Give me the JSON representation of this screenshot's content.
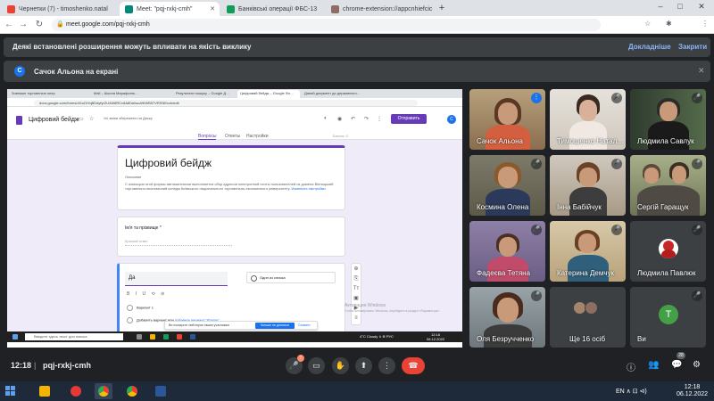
{
  "browser": {
    "tabs": [
      {
        "label": "Чернетки (7) - timoshenko.natal",
        "active": false
      },
      {
        "label": "Meet: \"pqj-rxkj-cmh\"",
        "active": true
      },
      {
        "label": "Банківські операції ФБС-13",
        "active": false
      },
      {
        "label": "chrome-extension://appcnhiefcic",
        "active": false
      }
    ],
    "new_tab": "+",
    "window_controls": {
      "minimize": "–",
      "maximize": "□",
      "close": "✕"
    },
    "url": "meet.google.com/pqj-rxkj-cmh",
    "nav": {
      "back": "←",
      "forward": "→",
      "reload": "↻"
    },
    "toolbar_icons": [
      "☆",
      "✱",
      "⋮"
    ]
  },
  "notice": {
    "text": "Деякі встановлені розширення можуть впливати на якість виклику",
    "details": "Докладніше",
    "close": "Закрити"
  },
  "presenting": {
    "badge": "С",
    "text": "Сачок Альона на екрані",
    "close": "✕"
  },
  "shared_screen": {
    "tabs": [
      "Зовнішні торговельні опер",
      "Mail – Школа Марафоню…",
      "Результати пошуку – Google Д…",
      "Цифровий бейдж – Google Фо…",
      "Даний документ до державного…"
    ],
    "url": "docs.google.com/forms/d/1uDiYqBDdyfyrZU4W8RCv6A80a0uuA9IWB57VRSNEcvk/edit",
    "form_name": "Цифровий бейдж",
    "saved_note": "Усі зміни збережено на Диску",
    "send": "Отправить",
    "avatar": "C",
    "form_tabs": [
      "Вопросы",
      "Ответы",
      "Настройки"
    ],
    "points": "Баллы: 0",
    "form_title": "Цифровий бейдж",
    "form_desc_label": "Описание",
    "form_desc": "С помощью этой формы автоматически выполняется сбор адресов электронной почты пользователей из домена Вінницький торговельно-економічний коледж Київського національного торговельно-економічного університету.",
    "form_desc_link": "Изменить настройки",
    "q1_title": "Ім'я та прізвище *",
    "q1_placeholder": "Краткий ответ",
    "q2_input": "Да",
    "q2_type": "Один из списка",
    "q2_format": "B I U ⟲ ⊘",
    "q2_option1": "Вариант 1",
    "q2_option2_text": "Добавить вариант или",
    "q2_option2_link": "добавить вариант \"Другое\"",
    "side_tools": [
      "⊕",
      "⎘",
      "Tт",
      "▣",
      "▶",
      "≡"
    ],
    "watermark_title": "Активация Windows",
    "watermark_text": "Чтобы активировать Windows, перейдите в раздел «Параметры».",
    "share_text": "Ви показуєте свій екран іншим учасникам",
    "share_stop": "Більше не ділитися",
    "share_hide": "Сховати",
    "taskbar_search": "Введите здесь текст для поиска",
    "taskbar_tray": "4°C Cloudy  ∧  ⊕  РУС",
    "taskbar_time": "12:18",
    "taskbar_date": "06.12.2022"
  },
  "participants": [
    {
      "name": "Сачок Альона",
      "mic": "on"
    },
    {
      "name": "Тимошенко Натал…",
      "mic": "off"
    },
    {
      "name": "Людмила Савлук",
      "mic": "off"
    },
    {
      "name": "Космина Олена",
      "mic": "off"
    },
    {
      "name": "Інна Бабійчук",
      "mic": "off"
    },
    {
      "name": "Сергій Гаращук",
      "mic": "off"
    },
    {
      "name": "Фадеєва Тетяна",
      "mic": "off"
    },
    {
      "name": "Катерина Демчук",
      "mic": "off"
    },
    {
      "name": "Людмила Павлюк",
      "mic": "off"
    },
    {
      "name": "Оля Безручченко",
      "mic": "off"
    },
    {
      "name": "Ще 16 осіб",
      "mic": ""
    },
    {
      "name": "Ви",
      "mic": "off",
      "avatar": "T"
    }
  ],
  "meetbar": {
    "time": "12:18",
    "separator": "|",
    "code": "pqj-rxkj-cmh",
    "mic_badge": "!",
    "buttons": {
      "mic": "🎤",
      "camera": "▭",
      "hand": "✋",
      "present": "⬆",
      "more": "⋮",
      "end": "☎"
    },
    "right": {
      "info": "ⓘ",
      "people": "👥",
      "people_count": "28",
      "chat": "💬",
      "activities": "⚙"
    }
  },
  "windows": {
    "tray": "EN  ∧  ⊡  ⊲)",
    "time": "12:18",
    "date": "06.12.2022"
  },
  "colors": {
    "meet_bg": "#202124",
    "accent": "#1a73e8",
    "form_purple": "#673ab7",
    "end_call": "#ea4335"
  }
}
